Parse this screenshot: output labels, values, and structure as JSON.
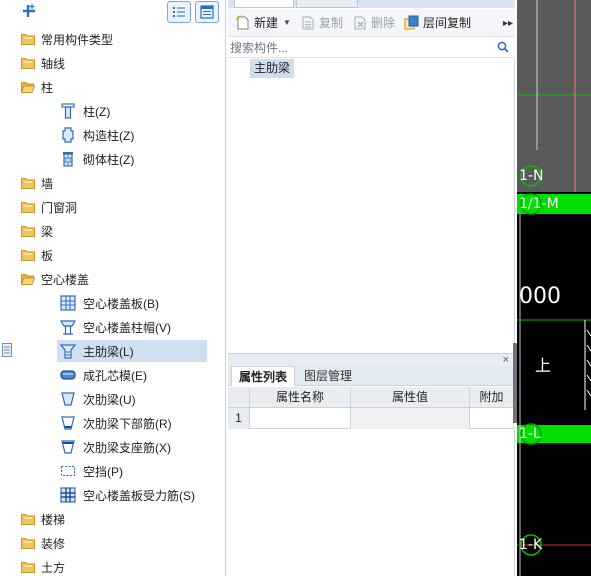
{
  "left_panel": {
    "add_icon": "add-component-plus-icon",
    "view_list_icon": "list-view-icon",
    "view_grid_icon": "grid-view-icon",
    "tree": [
      {
        "label": "常用构件类型",
        "level": 1,
        "icon": "folder-icon"
      },
      {
        "label": "轴线",
        "level": 1,
        "icon": "folder-icon"
      },
      {
        "label": "柱",
        "level": 1,
        "icon": "folder-open-icon"
      },
      {
        "label": "柱(Z)",
        "level": 2,
        "icon": "column-icon"
      },
      {
        "label": "构造柱(Z)",
        "level": 2,
        "icon": "constructional-column-icon"
      },
      {
        "label": "砌体柱(Z)",
        "level": 2,
        "icon": "masonry-column-icon"
      },
      {
        "label": "墙",
        "level": 1,
        "icon": "folder-icon"
      },
      {
        "label": "门窗洞",
        "level": 1,
        "icon": "folder-icon"
      },
      {
        "label": "梁",
        "level": 1,
        "icon": "folder-icon"
      },
      {
        "label": "板",
        "level": 1,
        "icon": "folder-icon"
      },
      {
        "label": "空心楼盖",
        "level": 1,
        "icon": "folder-open-icon"
      },
      {
        "label": "空心楼盖板(B)",
        "level": 2,
        "icon": "hollow-slab-icon"
      },
      {
        "label": "空心楼盖柱帽(V)",
        "level": 2,
        "icon": "column-cap-icon"
      },
      {
        "label": "主肋梁(L)",
        "level": 2,
        "icon": "main-rib-beam-icon",
        "selected": true
      },
      {
        "label": "成孔芯模(E)",
        "level": 2,
        "icon": "core-mold-icon"
      },
      {
        "label": "次肋梁(U)",
        "level": 2,
        "icon": "secondary-rib-beam-icon"
      },
      {
        "label": "次肋梁下部筋(R)",
        "level": 2,
        "icon": "bottom-rebar-icon"
      },
      {
        "label": "次肋梁支座筋(X)",
        "level": 2,
        "icon": "support-rebar-icon"
      },
      {
        "label": "空挡(P)",
        "level": 2,
        "icon": "void-gap-icon"
      },
      {
        "label": "空心楼盖板受力筋(S)",
        "level": 2,
        "icon": "slab-rebar-icon"
      },
      {
        "label": "楼梯",
        "level": 1,
        "icon": "folder-icon"
      },
      {
        "label": "装修",
        "level": 1,
        "icon": "folder-icon"
      },
      {
        "label": "土方",
        "level": 1,
        "icon": "folder-icon"
      }
    ]
  },
  "component_panel": {
    "toolbar": {
      "new_label": "新建",
      "copy_label": "复制",
      "delete_label": "删除",
      "floor_copy_label": "层间复制",
      "more_label": "▸▸"
    },
    "search_placeholder": "搜索构件...",
    "items": [
      "主肋梁"
    ]
  },
  "property_panel": {
    "close_label": "×",
    "tabs": [
      "属性列表",
      "图层管理"
    ],
    "columns": [
      "属性名称",
      "属性值",
      "附加"
    ],
    "rows": [
      {
        "index": "1",
        "name": "",
        "value": "",
        "extra": ""
      }
    ]
  },
  "canvas": {
    "background": "#000000",
    "grid_color": "#00ff00",
    "axis_labels": [
      "1-N",
      "1/1-M",
      "000",
      "上",
      "1-L",
      "1-K"
    ]
  },
  "colors": {
    "selection": "#cfdff1",
    "folder": "#f2c45a",
    "icon_blue": "#2f6db7",
    "accent": "#2b6fcc"
  }
}
